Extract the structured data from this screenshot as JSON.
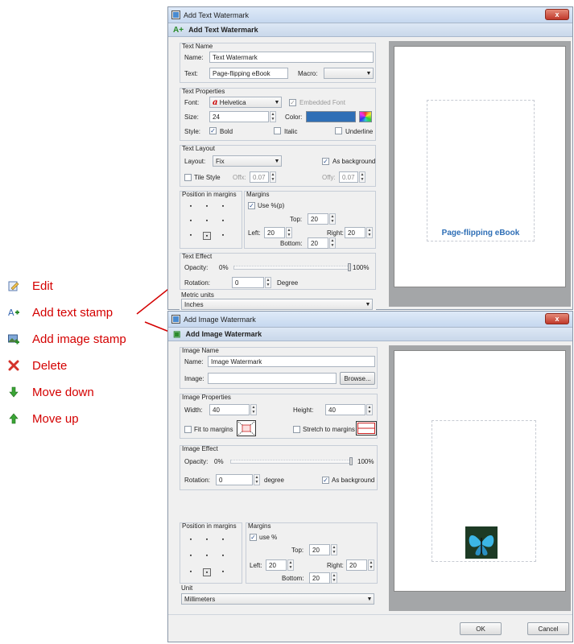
{
  "left_menu": {
    "items": [
      {
        "label": "Edit",
        "icon": "edit-icon"
      },
      {
        "label": "Add text stamp",
        "icon": "add-text-icon"
      },
      {
        "label": "Add image stamp",
        "icon": "add-image-icon"
      },
      {
        "label": "Delete",
        "icon": "delete-icon"
      },
      {
        "label": "Move down",
        "icon": "arrow-down-icon"
      },
      {
        "label": "Move up",
        "icon": "arrow-up-icon"
      }
    ]
  },
  "text_dialog": {
    "title": "Add Text Watermark",
    "header": "Add Text Watermark",
    "close_label": "x",
    "text_name_group": "Text Name",
    "name_label": "Name:",
    "name_value": "Text Watermark",
    "text_label": "Text:",
    "text_value": "Page-flipping eBook",
    "macro_label": "Macro:",
    "text_props_group": "Text Properties",
    "font_label": "Font:",
    "font_value": "Helvetica",
    "embedded_font_label": "Embedded Font",
    "size_label": "Size:",
    "size_value": "24",
    "color_label": "Color:",
    "color_value": "#2f6fb6",
    "style_label": "Style:",
    "bold_label": "Bold",
    "italic_label": "Italic",
    "underline_label": "Underline",
    "text_layout_group": "Text Layout",
    "layout_label": "Layout:",
    "layout_value": "Fix",
    "as_background_label": "As background",
    "tile_style_label": "Tile Style",
    "offx_label": "Offx:",
    "offx_value": "0.07",
    "offy_label": "Offy:",
    "offy_value": "0.07",
    "position_group": "Position in margins",
    "margins_group": "Margins",
    "use_percent_label": "Use %(p)",
    "top_label": "Top:",
    "top_value": "20",
    "left_label": "Left:",
    "left_value": "20",
    "right_label": "Right:",
    "right_value": "20",
    "bottom_label": "Bottom:",
    "bottom_value": "20",
    "text_effect_group": "Text Effect",
    "opacity_label": "Opacity:",
    "opacity_min": "0%",
    "opacity_max": "100%",
    "opacity_fraction": 1.0,
    "rotation_label": "Rotation:",
    "rotation_value": "0",
    "degree_label": "Degree",
    "metric_group": "Metric units",
    "metric_value": "Inches",
    "preview_text": "Page-flipping eBook"
  },
  "image_dialog": {
    "title": "Add Image Watermark",
    "header": "Add Image Watermark",
    "close_label": "x",
    "image_name_group": "Image Name",
    "name_label": "Name:",
    "name_value": "Image Watermark",
    "image_label": "Image:",
    "image_value": "",
    "browse_label": "Browse...",
    "image_props_group": "Image Properties",
    "width_label": "Width:",
    "width_value": "40",
    "height_label": "Height:",
    "height_value": "40",
    "fit_label": "Fit to margins",
    "stretch_label": "Stretch to margins",
    "image_effect_group": "Image Effect",
    "opacity_label": "Opacity:",
    "opacity_min": "0%",
    "opacity_max": "100%",
    "opacity_fraction": 1.0,
    "rotation_label": "Rotation:",
    "rotation_value": "0",
    "degree_label": "degree",
    "as_background_label": "As background",
    "position_group": "Position in margins",
    "margins_group": "Margins",
    "use_percent_label": "use %",
    "top_label": "Top:",
    "top_value": "20",
    "left_label": "Left:",
    "left_value": "20",
    "right_label": "Right:",
    "right_value": "20",
    "bottom_label": "Bottom:",
    "bottom_value": "20",
    "unit_group": "Unit",
    "unit_value": "Millimeters",
    "ok_label": "OK",
    "cancel_label": "Cancel"
  },
  "colors": {
    "menu_text": "#d40000",
    "preview_bg": "#a4a6a8",
    "accent_blue": "#2f6fb6"
  }
}
